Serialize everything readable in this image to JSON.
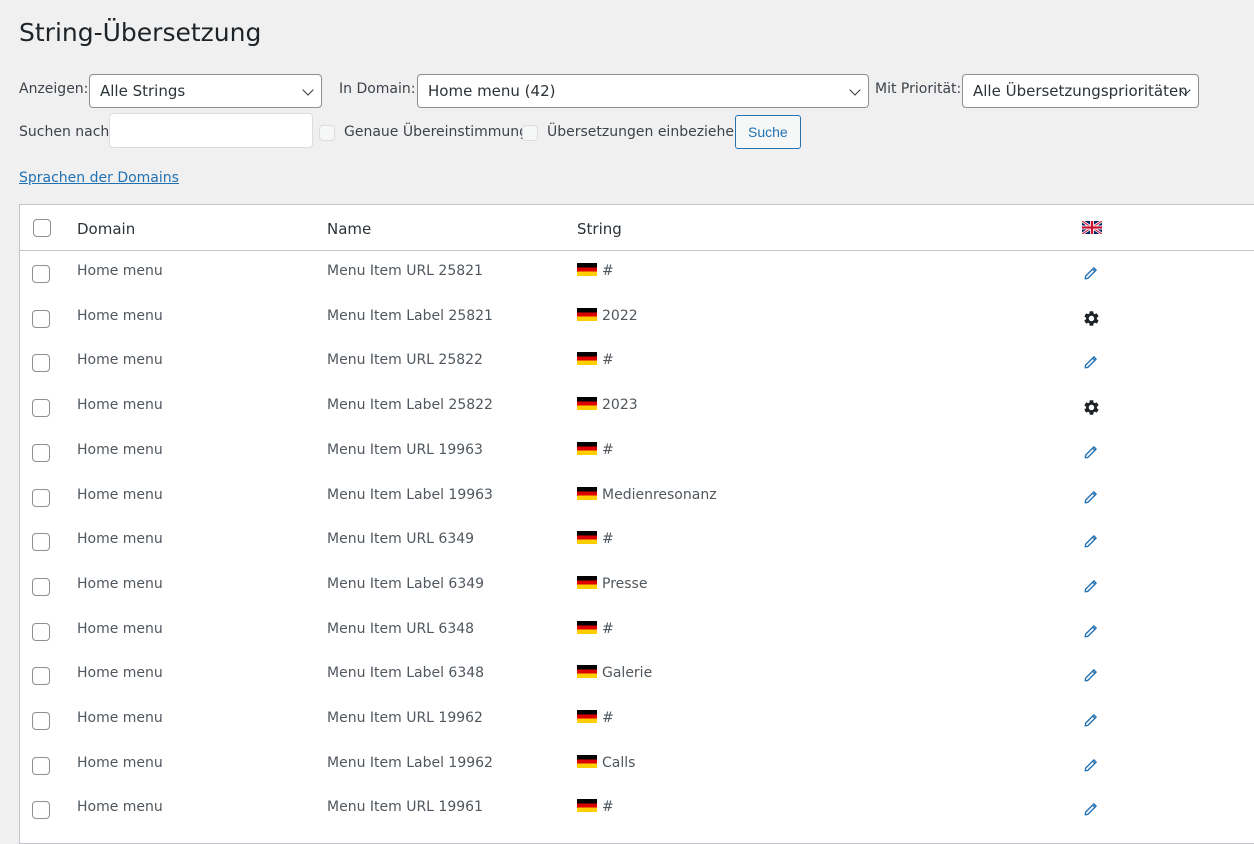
{
  "page": {
    "title": "String-Übersetzung"
  },
  "filters": {
    "show_label": "Anzeigen:",
    "show_value": "Alle Strings",
    "domain_label": "In Domain:",
    "domain_value": "Home menu (42)",
    "priority_label": "Mit Priorität:",
    "priority_value": "Alle Übersetzungsprioritäten",
    "search_label": "Suchen nach:",
    "search_value": "",
    "exact_match_label": "Genaue Übereinstimmung",
    "include_translations_label": "Übersetzungen einbeziehen",
    "search_button": "Suche"
  },
  "domain_languages_link": "Sprachen der Domains",
  "table": {
    "columns": {
      "domain": "Domain",
      "name": "Name",
      "string": "String"
    },
    "rows": [
      {
        "domain": "Home menu",
        "name": "Menu Item URL 25821",
        "string": "#",
        "action": "pencil-icon"
      },
      {
        "domain": "Home menu",
        "name": "Menu Item Label 25821",
        "string": "2022",
        "action": "gear-icon"
      },
      {
        "domain": "Home menu",
        "name": "Menu Item URL 25822",
        "string": "#",
        "action": "pencil-icon"
      },
      {
        "domain": "Home menu",
        "name": "Menu Item Label 25822",
        "string": "2023",
        "action": "gear-icon"
      },
      {
        "domain": "Home menu",
        "name": "Menu Item URL 19963",
        "string": "#",
        "action": "pencil-icon"
      },
      {
        "domain": "Home menu",
        "name": "Menu Item Label 19963",
        "string": "Medienresonanz",
        "action": "pencil-icon"
      },
      {
        "domain": "Home menu",
        "name": "Menu Item URL 6349",
        "string": "#",
        "action": "pencil-icon"
      },
      {
        "domain": "Home menu",
        "name": "Menu Item Label 6349",
        "string": "Presse",
        "action": "pencil-icon"
      },
      {
        "domain": "Home menu",
        "name": "Menu Item URL 6348",
        "string": "#",
        "action": "pencil-icon"
      },
      {
        "domain": "Home menu",
        "name": "Menu Item Label 6348",
        "string": "Galerie",
        "action": "pencil-icon"
      },
      {
        "domain": "Home menu",
        "name": "Menu Item URL 19962",
        "string": "#",
        "action": "pencil-icon"
      },
      {
        "domain": "Home menu",
        "name": "Menu Item Label 19962",
        "string": "Calls",
        "action": "pencil-icon"
      },
      {
        "domain": "Home menu",
        "name": "Menu Item URL 19961",
        "string": "#",
        "action": "pencil-icon"
      }
    ]
  },
  "colors": {
    "accent": "#2271b1",
    "text": "#3c434a",
    "background": "#f0f0f1"
  }
}
